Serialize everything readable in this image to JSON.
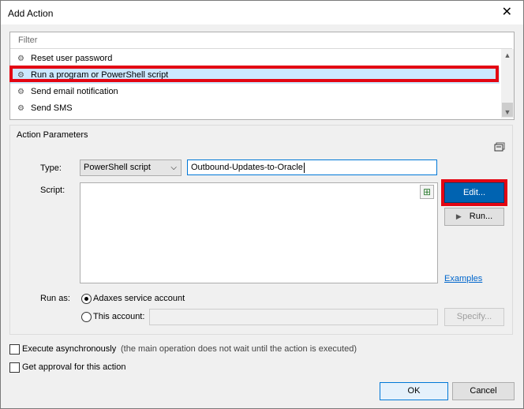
{
  "window": {
    "title": "Add Action",
    "close_glyph": "✕"
  },
  "list": {
    "filter_placeholder": "Filter",
    "items": [
      {
        "label": "Reset user password",
        "icon": "gear-icon"
      },
      {
        "label": "Run a program or PowerShell script",
        "icon": "gear-icon",
        "selected": true
      },
      {
        "label": "Send email notification",
        "icon": "gear-icon"
      },
      {
        "label": "Send SMS",
        "icon": "gear-icon"
      }
    ]
  },
  "params": {
    "group_label": "Action Parameters",
    "type_label": "Type:",
    "type_value": "PowerShell script",
    "name_value": "Outbound-Updates-to-Oracle",
    "script_label": "Script:",
    "edit_label": "Edit...",
    "run_label": "Run...",
    "examples_link": "Examples",
    "run_as_label": "Run as:",
    "service_account_label": "Adaxes service account",
    "this_account_label": "This account:",
    "specify_label": "Specify..."
  },
  "options": {
    "async_label": "Execute asynchronously",
    "async_note": "(the main operation does not wait until the action is executed)",
    "approval_label": "Get approval for this action"
  },
  "footer": {
    "ok_label": "OK",
    "cancel_label": "Cancel"
  },
  "colors": {
    "highlight": "#e30613",
    "selection": "#cce8ff",
    "primary_button": "#0063b1",
    "link": "#0066cc"
  }
}
